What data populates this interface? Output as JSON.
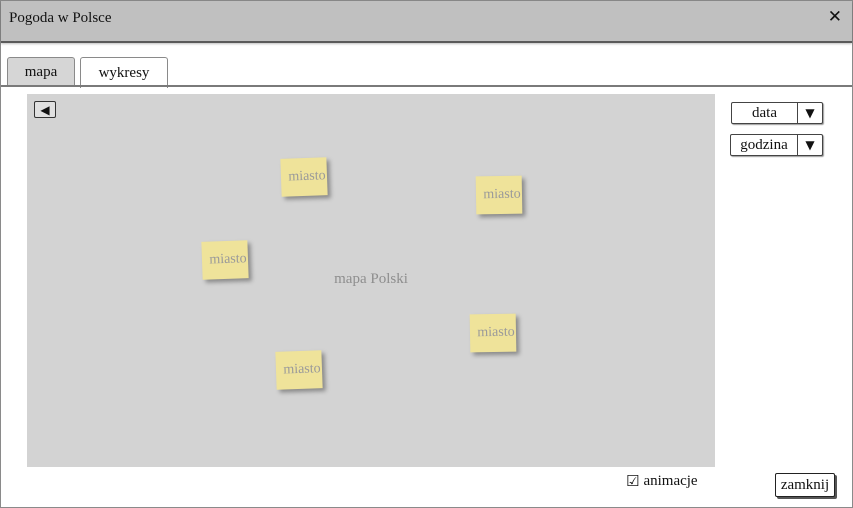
{
  "window": {
    "title": "Pogoda w Polsce",
    "close_glyph": "✕"
  },
  "tabs": [
    {
      "label": "mapa",
      "active": true
    },
    {
      "label": "wykresy",
      "active": false
    }
  ],
  "map": {
    "placeholder": "mapa Polski",
    "back_icon": "◀",
    "cities": [
      {
        "label": "miasto"
      },
      {
        "label": "miasto"
      },
      {
        "label": "miasto"
      },
      {
        "label": "miasto"
      },
      {
        "label": "miasto"
      }
    ]
  },
  "controls": {
    "date_label": "data",
    "hour_label": "godzina",
    "arrow": "▼"
  },
  "footer": {
    "animation_checkbox_glyph": "☑",
    "animation_label": "animacje",
    "animation_checked": true,
    "close_button": "zamknij"
  }
}
